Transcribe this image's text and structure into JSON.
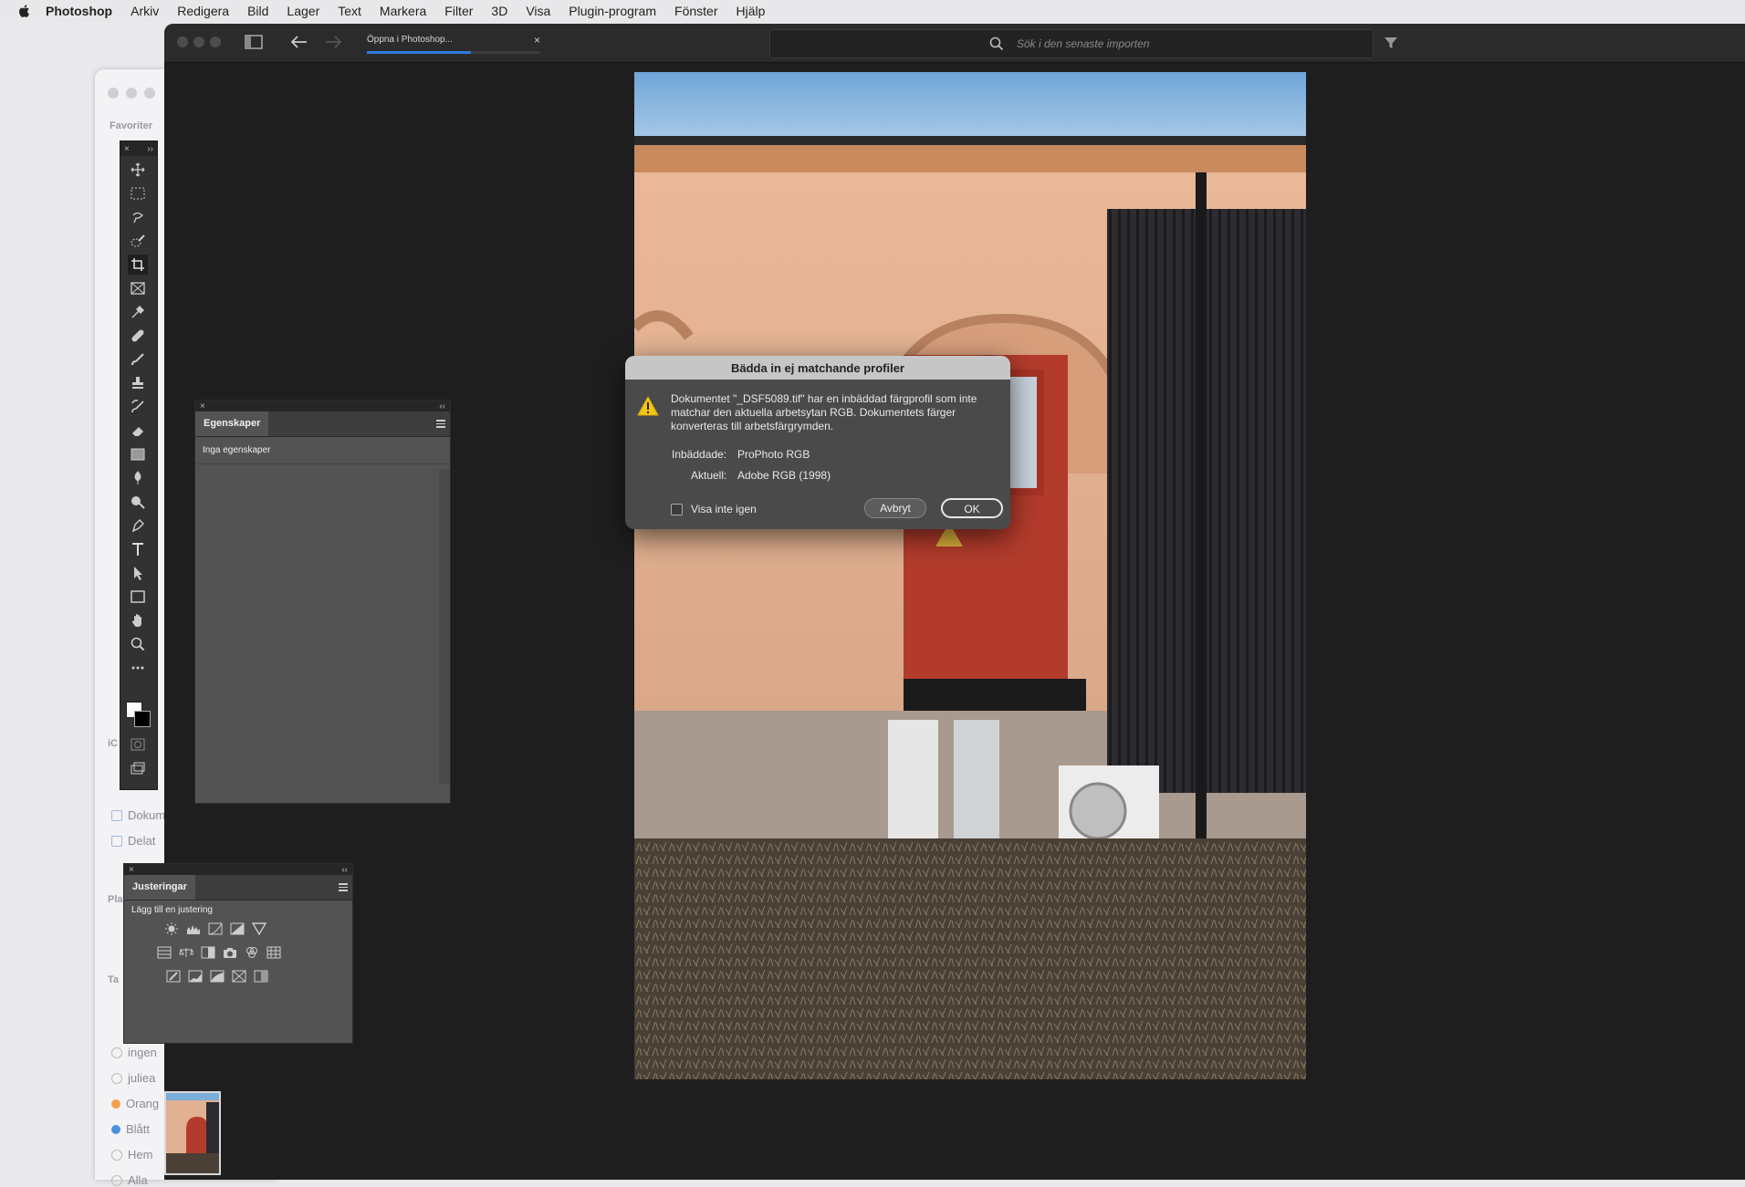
{
  "menubar": {
    "items": [
      "Photoshop",
      "Arkiv",
      "Redigera",
      "Bild",
      "Lager",
      "Text",
      "Markera",
      "Filter",
      "3D",
      "Visa",
      "Plugin-program",
      "Fönster",
      "Hjälp"
    ]
  },
  "finder": {
    "favorites_label": "Favoriter",
    "items": [
      "Dokument",
      "Delat"
    ],
    "tags_label": "Ta",
    "places_label": "Pla",
    "icloud_label": "iC",
    "tags": [
      {
        "label": "ingen",
        "color": "#cfcfd4"
      },
      {
        "label": "juliea",
        "color": "#cfcfd4"
      },
      {
        "label": "Orang",
        "color": "#f2a04a"
      },
      {
        "label": "Blått",
        "color": "#4a90e2"
      },
      {
        "label": "Hem",
        "color": "#cfcfd4"
      },
      {
        "label": "Alla",
        "color": "#cfcfd4"
      }
    ]
  },
  "ps": {
    "tab_label": "Öppna i Photoshop...",
    "tab_close": "×",
    "progress": 0.6,
    "search_placeholder": "Sök i den senaste importen"
  },
  "properties_panel": {
    "tab": "Egenskaper",
    "content": "Inga egenskaper"
  },
  "adjustments_panel": {
    "tab": "Justeringar",
    "subtitle": "Lägg till en justering"
  },
  "dialog": {
    "title": "Bädda in ej matchande profiler",
    "message": "Dokumentet \"_DSF5089.tif\" har en inbäddad färgprofil som inte matchar den aktuella arbetsytan RGB.  Dokumentets färger konverteras till arbetsfärgrymden.",
    "embedded_label": "Inbäddade:",
    "embedded_value": "ProPhoto RGB",
    "current_label": "Aktuell:",
    "current_value": "Adobe RGB (1998)",
    "dont_show_label": "Visa inte igen",
    "cancel_label": "Avbryt",
    "ok_label": "OK"
  },
  "colors": {
    "accent": "#2f7bdf",
    "ui_dark": "#1e1e1e",
    "panel": "#535353"
  }
}
